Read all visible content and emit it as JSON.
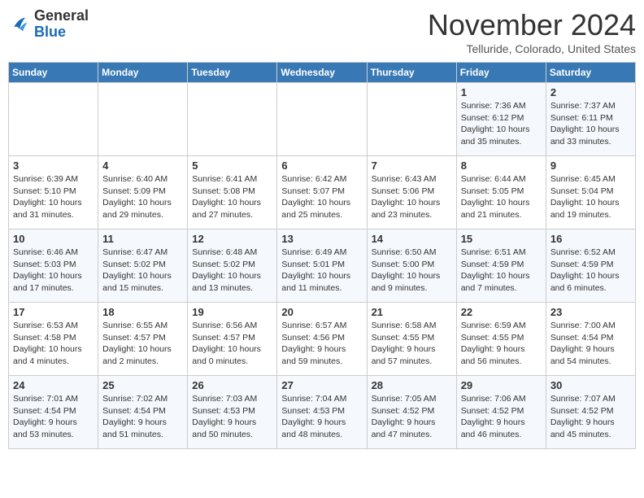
{
  "header": {
    "logo": {
      "general": "General",
      "blue": "Blue"
    },
    "title": "November 2024",
    "location": "Telluride, Colorado, United States"
  },
  "weekdays": [
    "Sunday",
    "Monday",
    "Tuesday",
    "Wednesday",
    "Thursday",
    "Friday",
    "Saturday"
  ],
  "weeks": [
    [
      {
        "day": "",
        "info": ""
      },
      {
        "day": "",
        "info": ""
      },
      {
        "day": "",
        "info": ""
      },
      {
        "day": "",
        "info": ""
      },
      {
        "day": "",
        "info": ""
      },
      {
        "day": "1",
        "info": "Sunrise: 7:36 AM\nSunset: 6:12 PM\nDaylight: 10 hours\nand 35 minutes."
      },
      {
        "day": "2",
        "info": "Sunrise: 7:37 AM\nSunset: 6:11 PM\nDaylight: 10 hours\nand 33 minutes."
      }
    ],
    [
      {
        "day": "3",
        "info": "Sunrise: 6:39 AM\nSunset: 5:10 PM\nDaylight: 10 hours\nand 31 minutes."
      },
      {
        "day": "4",
        "info": "Sunrise: 6:40 AM\nSunset: 5:09 PM\nDaylight: 10 hours\nand 29 minutes."
      },
      {
        "day": "5",
        "info": "Sunrise: 6:41 AM\nSunset: 5:08 PM\nDaylight: 10 hours\nand 27 minutes."
      },
      {
        "day": "6",
        "info": "Sunrise: 6:42 AM\nSunset: 5:07 PM\nDaylight: 10 hours\nand 25 minutes."
      },
      {
        "day": "7",
        "info": "Sunrise: 6:43 AM\nSunset: 5:06 PM\nDaylight: 10 hours\nand 23 minutes."
      },
      {
        "day": "8",
        "info": "Sunrise: 6:44 AM\nSunset: 5:05 PM\nDaylight: 10 hours\nand 21 minutes."
      },
      {
        "day": "9",
        "info": "Sunrise: 6:45 AM\nSunset: 5:04 PM\nDaylight: 10 hours\nand 19 minutes."
      }
    ],
    [
      {
        "day": "10",
        "info": "Sunrise: 6:46 AM\nSunset: 5:03 PM\nDaylight: 10 hours\nand 17 minutes."
      },
      {
        "day": "11",
        "info": "Sunrise: 6:47 AM\nSunset: 5:02 PM\nDaylight: 10 hours\nand 15 minutes."
      },
      {
        "day": "12",
        "info": "Sunrise: 6:48 AM\nSunset: 5:02 PM\nDaylight: 10 hours\nand 13 minutes."
      },
      {
        "day": "13",
        "info": "Sunrise: 6:49 AM\nSunset: 5:01 PM\nDaylight: 10 hours\nand 11 minutes."
      },
      {
        "day": "14",
        "info": "Sunrise: 6:50 AM\nSunset: 5:00 PM\nDaylight: 10 hours\nand 9 minutes."
      },
      {
        "day": "15",
        "info": "Sunrise: 6:51 AM\nSunset: 4:59 PM\nDaylight: 10 hours\nand 7 minutes."
      },
      {
        "day": "16",
        "info": "Sunrise: 6:52 AM\nSunset: 4:59 PM\nDaylight: 10 hours\nand 6 minutes."
      }
    ],
    [
      {
        "day": "17",
        "info": "Sunrise: 6:53 AM\nSunset: 4:58 PM\nDaylight: 10 hours\nand 4 minutes."
      },
      {
        "day": "18",
        "info": "Sunrise: 6:55 AM\nSunset: 4:57 PM\nDaylight: 10 hours\nand 2 minutes."
      },
      {
        "day": "19",
        "info": "Sunrise: 6:56 AM\nSunset: 4:57 PM\nDaylight: 10 hours\nand 0 minutes."
      },
      {
        "day": "20",
        "info": "Sunrise: 6:57 AM\nSunset: 4:56 PM\nDaylight: 9 hours\nand 59 minutes."
      },
      {
        "day": "21",
        "info": "Sunrise: 6:58 AM\nSunset: 4:55 PM\nDaylight: 9 hours\nand 57 minutes."
      },
      {
        "day": "22",
        "info": "Sunrise: 6:59 AM\nSunset: 4:55 PM\nDaylight: 9 hours\nand 56 minutes."
      },
      {
        "day": "23",
        "info": "Sunrise: 7:00 AM\nSunset: 4:54 PM\nDaylight: 9 hours\nand 54 minutes."
      }
    ],
    [
      {
        "day": "24",
        "info": "Sunrise: 7:01 AM\nSunset: 4:54 PM\nDaylight: 9 hours\nand 53 minutes."
      },
      {
        "day": "25",
        "info": "Sunrise: 7:02 AM\nSunset: 4:54 PM\nDaylight: 9 hours\nand 51 minutes."
      },
      {
        "day": "26",
        "info": "Sunrise: 7:03 AM\nSunset: 4:53 PM\nDaylight: 9 hours\nand 50 minutes."
      },
      {
        "day": "27",
        "info": "Sunrise: 7:04 AM\nSunset: 4:53 PM\nDaylight: 9 hours\nand 48 minutes."
      },
      {
        "day": "28",
        "info": "Sunrise: 7:05 AM\nSunset: 4:52 PM\nDaylight: 9 hours\nand 47 minutes."
      },
      {
        "day": "29",
        "info": "Sunrise: 7:06 AM\nSunset: 4:52 PM\nDaylight: 9 hours\nand 46 minutes."
      },
      {
        "day": "30",
        "info": "Sunrise: 7:07 AM\nSunset: 4:52 PM\nDaylight: 9 hours\nand 45 minutes."
      }
    ]
  ]
}
